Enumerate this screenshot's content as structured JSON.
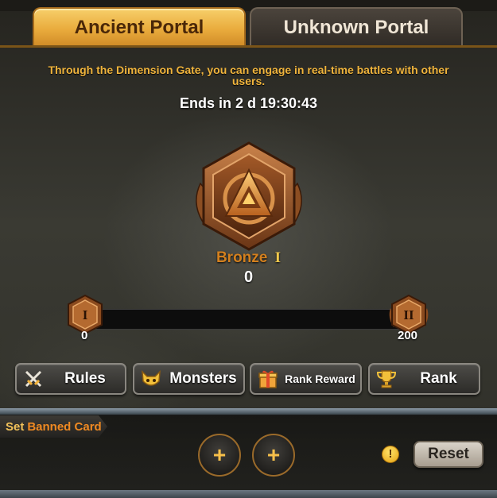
{
  "tabs": [
    {
      "label": "Ancient Portal",
      "active": true
    },
    {
      "label": "Unknown Portal",
      "active": false
    }
  ],
  "description": "Through the Dimension Gate, you can engage in real-time battles with other users.",
  "timer": "Ends in 2 d 19:30:43",
  "rank": {
    "tier": "Bronze",
    "tier_level": "I",
    "points": "0"
  },
  "progress": {
    "current": 0,
    "min_label": "0",
    "max_label": "200",
    "min_badge": "I",
    "max_badge": "II"
  },
  "buttons": {
    "rules": "Rules",
    "monsters": "Monsters",
    "rank_reward": "Rank Reward",
    "rank": "Rank"
  },
  "banned": {
    "prefix": "Set",
    "highlight": "Banned Card"
  },
  "slots": [
    "+",
    "+"
  ],
  "info_icon": "!",
  "reset_label": "Reset",
  "colors": {
    "accent_gold": "#f0b43c",
    "bronze": "#d4801e",
    "tab_active": "#e9ab3c",
    "tab_inactive": "#2f2a25"
  },
  "icons": {
    "rules": "crossed-swords-icon",
    "monsters": "monster-face-icon",
    "rank_reward": "gift-box-icon",
    "rank": "trophy-icon"
  }
}
